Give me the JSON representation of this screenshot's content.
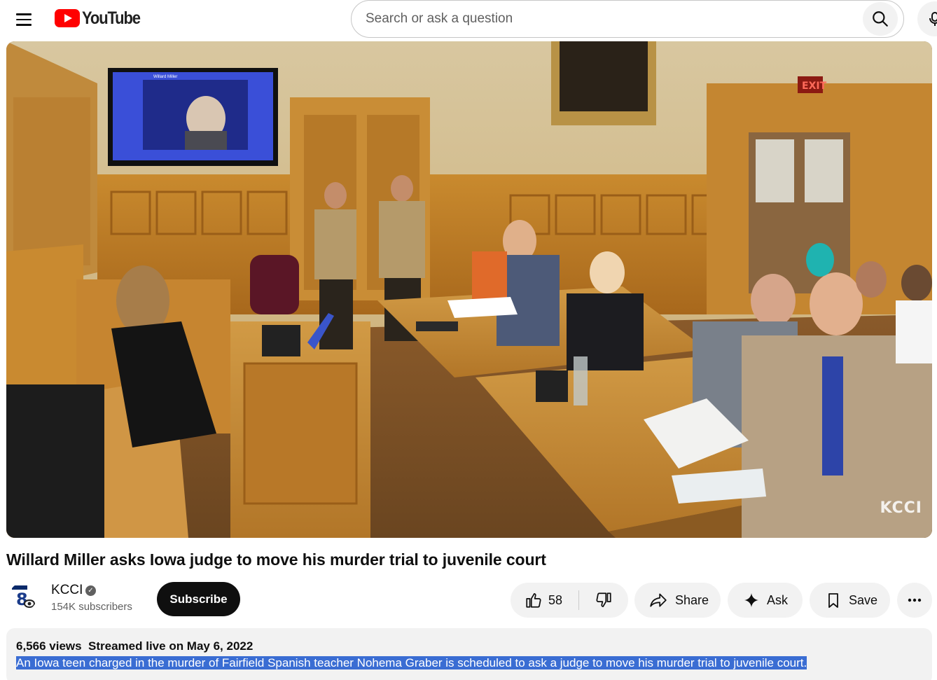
{
  "header": {
    "logo_text": "YouTube",
    "search_placeholder": "Search or ask a question",
    "colors": {
      "brand": "#ff0000"
    }
  },
  "player": {
    "watermark": "KCCI",
    "monitor_text": "Willard Miller",
    "exit_sign": "EXIT"
  },
  "video": {
    "title": "Willard Miller asks Iowa judge to move his murder trial to juvenile court"
  },
  "channel": {
    "name": "KCCI",
    "subscribers": "154K subscribers",
    "subscribe_label": "Subscribe",
    "verified": true
  },
  "actions": {
    "likes": "58",
    "share_label": "Share",
    "ask_label": "Ask",
    "save_label": "Save"
  },
  "description": {
    "views": "6,566 views",
    "streamed": "Streamed live on May 6, 2022",
    "text": "An Iowa teen charged in the murder of Fairfield Spanish teacher Nohema Graber is scheduled to ask a judge to move his murder trial to juvenile court."
  }
}
